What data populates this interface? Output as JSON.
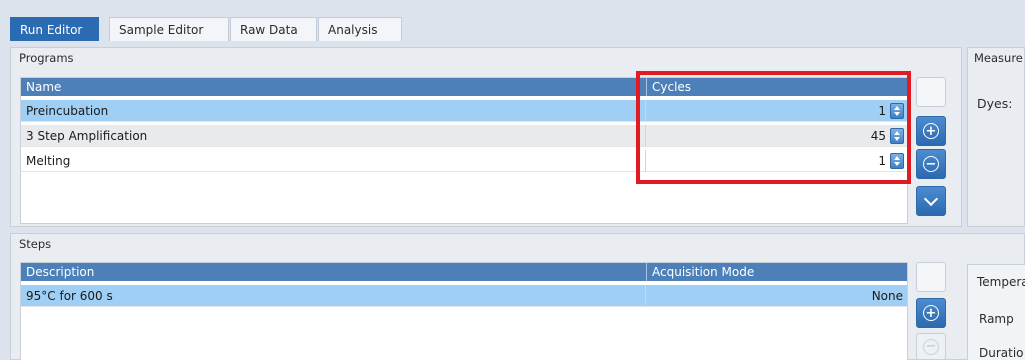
{
  "tabs": [
    {
      "label": "Run Editor",
      "active": true
    },
    {
      "label": "Sample Editor",
      "active": false
    },
    {
      "label": "Raw Data",
      "active": false
    },
    {
      "label": "Analysis",
      "active": false
    }
  ],
  "programs": {
    "title": "Programs",
    "columns": [
      "Name",
      "Cycles"
    ],
    "rows": [
      {
        "name": "Preincubation",
        "cycles": "1",
        "selected": true
      },
      {
        "name": "3 Step Amplification",
        "cycles": "45",
        "selected": false
      },
      {
        "name": "Melting",
        "cycles": "1",
        "selected": false
      }
    ]
  },
  "steps": {
    "title": "Steps",
    "columns": [
      "Description",
      "Acquisition Mode"
    ],
    "rows": [
      {
        "description": "95°C for 600 s",
        "mode": "None",
        "selected": true
      }
    ]
  },
  "measurement": {
    "title": "Measure",
    "dyes_label": "Dyes:"
  },
  "temperature": {
    "title": "Tempera",
    "ramp_label": "Ramp",
    "duration_label": "Duratio"
  },
  "icons": {
    "add": "plus-circle-icon",
    "remove": "minus-circle-icon",
    "down": "chevron-down-icon"
  },
  "colors": {
    "accent": "#2b6bb2",
    "header": "#4d7fb9",
    "selected_row": "#9fcff4",
    "highlight": "#e21b23"
  }
}
